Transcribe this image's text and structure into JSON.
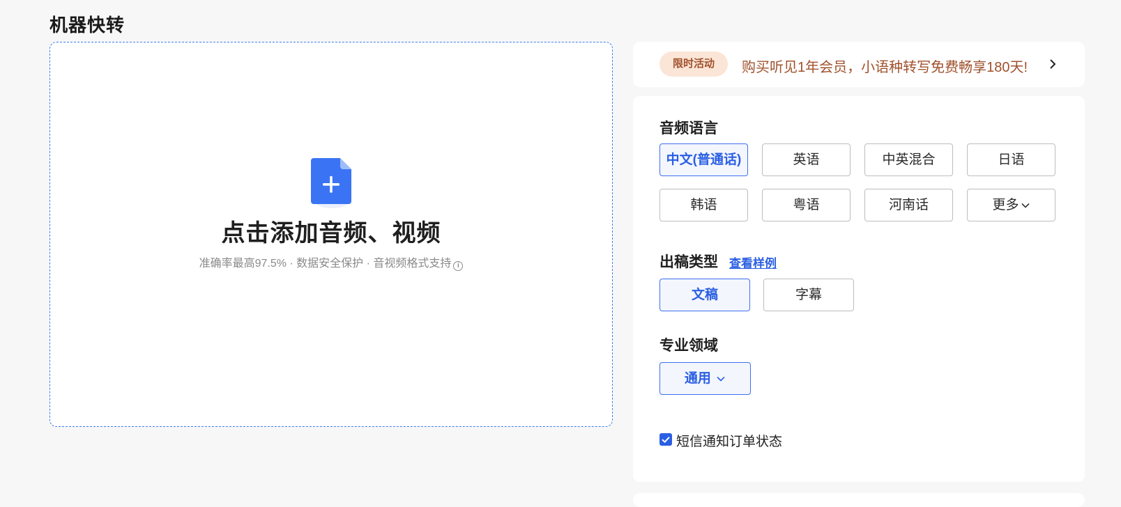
{
  "page": {
    "title": "机器快转"
  },
  "upload": {
    "title": "点击添加音频、视频",
    "subtitle": "准确率最高97.5% · 数据安全保护 · 音视频格式支持",
    "icon": "file-add-icon",
    "accent_color": "#3c7bf0"
  },
  "promo": {
    "badge": "限时活动",
    "text": "购买听见1年会员，小语种转写免费畅享180天!",
    "color": "#a0522d"
  },
  "language": {
    "label": "音频语言",
    "options": [
      "中文(普通话)",
      "英语",
      "中英混合",
      "日语",
      "韩语",
      "粤语",
      "河南话",
      "更多"
    ],
    "selected": "中文(普通话)"
  },
  "output": {
    "label": "出稿类型",
    "sample_link": "查看样例",
    "options": [
      "文稿",
      "字幕"
    ],
    "selected": "文稿"
  },
  "domain": {
    "label": "专业领域",
    "selected": "通用"
  },
  "sms": {
    "label": "短信通知订单状态",
    "checked": true
  },
  "colors": {
    "primary": "#2b5fe3",
    "background": "#f7f7f7"
  }
}
